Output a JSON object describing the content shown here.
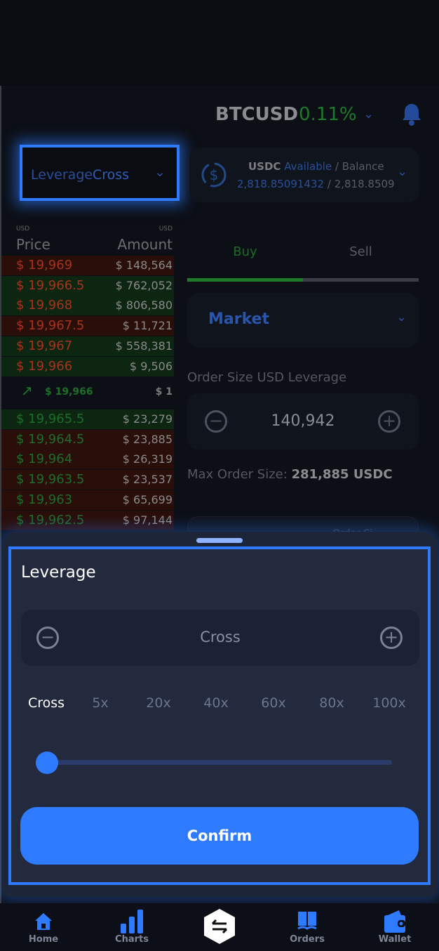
{
  "header": {
    "pair": "BTCUSD",
    "change": "0.11%"
  },
  "leverage_select": {
    "label": "Leverage",
    "value": "Cross"
  },
  "balance": {
    "currency": "USDC",
    "available_label": "Available",
    "balance_label": "/ Balance",
    "available": "2,818.85091432",
    "separator": "/",
    "total": "2,818.850914"
  },
  "orderbook": {
    "price_unit": "USD",
    "amount_unit": "USD",
    "price_header": "Price",
    "amount_header": "Amount",
    "asks": [
      {
        "price": "$ 19,969",
        "amount": "$ 148,564",
        "bg": "red"
      },
      {
        "price": "$ 19,966.5",
        "amount": "$ 762,052",
        "bg": "green"
      },
      {
        "price": "$ 19,968",
        "amount": "$ 806,580",
        "bg": "green"
      },
      {
        "price": "$ 19,967.5",
        "amount": "$ 11,721",
        "bg": "red"
      },
      {
        "price": "$ 19,967",
        "amount": "$ 558,381",
        "bg": "green"
      },
      {
        "price": "$ 19,966",
        "amount": "$ 9,506",
        "bg": "green"
      }
    ],
    "last": {
      "price": "$ 19,966",
      "amount": "$ 1"
    },
    "bids": [
      {
        "price": "$ 19,965.5",
        "amount": "$ 23,279",
        "bg": "green"
      },
      {
        "price": "$ 19,964.5",
        "amount": "$ 23,885",
        "bg": "red"
      },
      {
        "price": "$ 19,964",
        "amount": "$ 26,319",
        "bg": "red"
      },
      {
        "price": "$ 19,963.5",
        "amount": "$ 23,537",
        "bg": "red"
      },
      {
        "price": "$ 19,963",
        "amount": "$ 65,699",
        "bg": "red"
      },
      {
        "price": "$ 19,962.5",
        "amount": "$ 97,144",
        "bg": "red"
      }
    ]
  },
  "trade": {
    "buy": "Buy",
    "sell": "Sell",
    "order_type": "Market",
    "order_size_label": "Order Size USD Leverage",
    "order_size": "140,942",
    "max_label": "Max Order Size:",
    "max_value": "281,885 USDC",
    "hidden_label": "Order Si"
  },
  "sheet": {
    "title": "Leverage",
    "value": "Cross",
    "options": [
      "Cross",
      "5x",
      "20x",
      "40x",
      "60x",
      "80x",
      "100x"
    ],
    "selected": "Cross",
    "slider_value": 0,
    "confirm": "Confirm"
  },
  "nav": {
    "home": "Home",
    "charts": "Charts",
    "orders": "Orders",
    "wallet": "Wallet"
  },
  "colors": {
    "accent": "#2f7bff",
    "green": "#1e7a2a",
    "red": "#a8321c"
  }
}
